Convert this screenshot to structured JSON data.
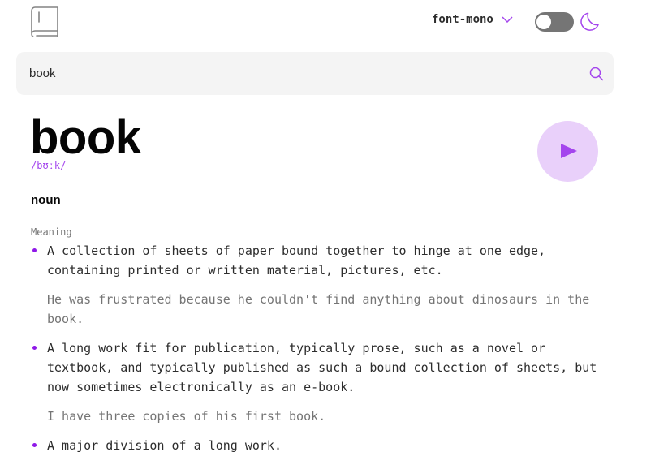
{
  "header": {
    "logo_icon": "book-icon",
    "font_selector": {
      "label": "font-mono",
      "icon": "chevron-down-icon"
    },
    "theme_toggle": {
      "state": "off",
      "icon": "moon-icon"
    }
  },
  "search": {
    "value": "book",
    "icon": "search-icon"
  },
  "entry": {
    "word": "book",
    "phonetic": "/bʊːk/",
    "play_icon": "play-icon",
    "part_of_speech": "noun",
    "meaning_heading": "Meaning",
    "definitions": [
      {
        "text": "A collection of sheets of paper bound together to hinge at one edge, containing printed or written material, pictures, etc.",
        "example": "He was frustrated because he couldn't find anything about dinosaurs in the book."
      },
      {
        "text": "A long work fit for publication, typically prose, such as a novel or textbook, and typically published as such a bound collection of sheets, but now sometimes electronically as an e-book.",
        "example": "I have three copies of his first book."
      },
      {
        "text": "A major division of a long work."
      }
    ]
  },
  "colors": {
    "accent": "#a445ed",
    "accent_light": "#e9d0fa",
    "text": "#2d2d2d",
    "muted": "#757575",
    "search_bg": "#f4f4f4"
  }
}
